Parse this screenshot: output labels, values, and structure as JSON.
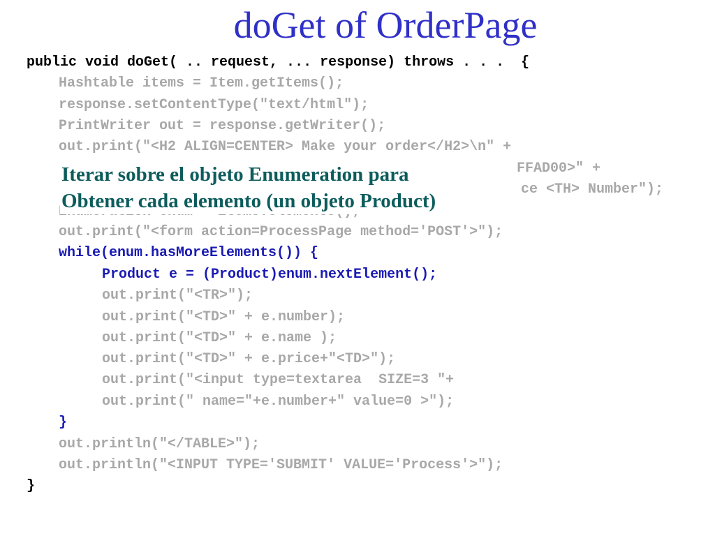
{
  "title": "doGet of OrderPage",
  "code_lines": [
    {
      "text": "public void doGet( .. request, ... response) throws . . .  {",
      "color": "black"
    },
    {
      "text": "Hashtable items = Item.getItems();",
      "color": "gray"
    },
    {
      "text": "response.setContentType(\"text/html\");",
      "color": "gray"
    },
    {
      "text": "PrintWriter out = response.getWriter();",
      "color": "gray"
    },
    {
      "text": "out.print(\"<H2 ALIGN=CENTER> Make your order</H2>\\n\" +",
      "color": "gray"
    },
    {
      "text": "FFAD00>\" +",
      "color": "gray"
    },
    {
      "text": "ce <TH> Number\");",
      "color": "gray"
    },
    {
      "text": "Enumeration enum = items.elements();",
      "color": "gray"
    },
    {
      "text": "out.print(\"<form action=ProcessPage method='POST'>\");",
      "color": "gray"
    },
    {
      "text": "while(enum.hasMoreElements()) {",
      "color": "blue"
    },
    {
      "text": "Product e = (Product)enum.nextElement();",
      "color": "blue"
    },
    {
      "text": "out.print(\"<TR>\");",
      "color": "gray"
    },
    {
      "text": "out.print(\"<TD>\" + e.number);",
      "color": "gray"
    },
    {
      "text": "out.print(\"<TD>\" + e.name );",
      "color": "gray"
    },
    {
      "text": "out.print(\"<TD>\" + e.price+\"<TD>\");",
      "color": "gray"
    },
    {
      "text": "out.print(\"<input type=textarea  SIZE=3 \"+",
      "color": "gray"
    },
    {
      "text": "out.print(\" name=\"+e.number+\" value=0 >\");",
      "color": "gray"
    },
    {
      "text": "}",
      "color": "blue"
    },
    {
      "text": "out.println(\"</TABLE>\");",
      "color": "gray"
    },
    {
      "text": "out.println(\"<INPUT TYPE='SUBMIT' VALUE='Process'>\");",
      "color": "gray"
    },
    {
      "text": "}",
      "color": "black"
    }
  ],
  "overlay_note": {
    "line1": "Iterar sobre el objeto Enumeration para",
    "line2": "Obtener cada elemento (un objeto  Product)"
  },
  "colors": {
    "title": "#3030c8",
    "code_default": "#000000",
    "code_dimmed": "#a8a8a8",
    "code_highlight": "#1a1ab4",
    "note": "#0d5c5c"
  }
}
